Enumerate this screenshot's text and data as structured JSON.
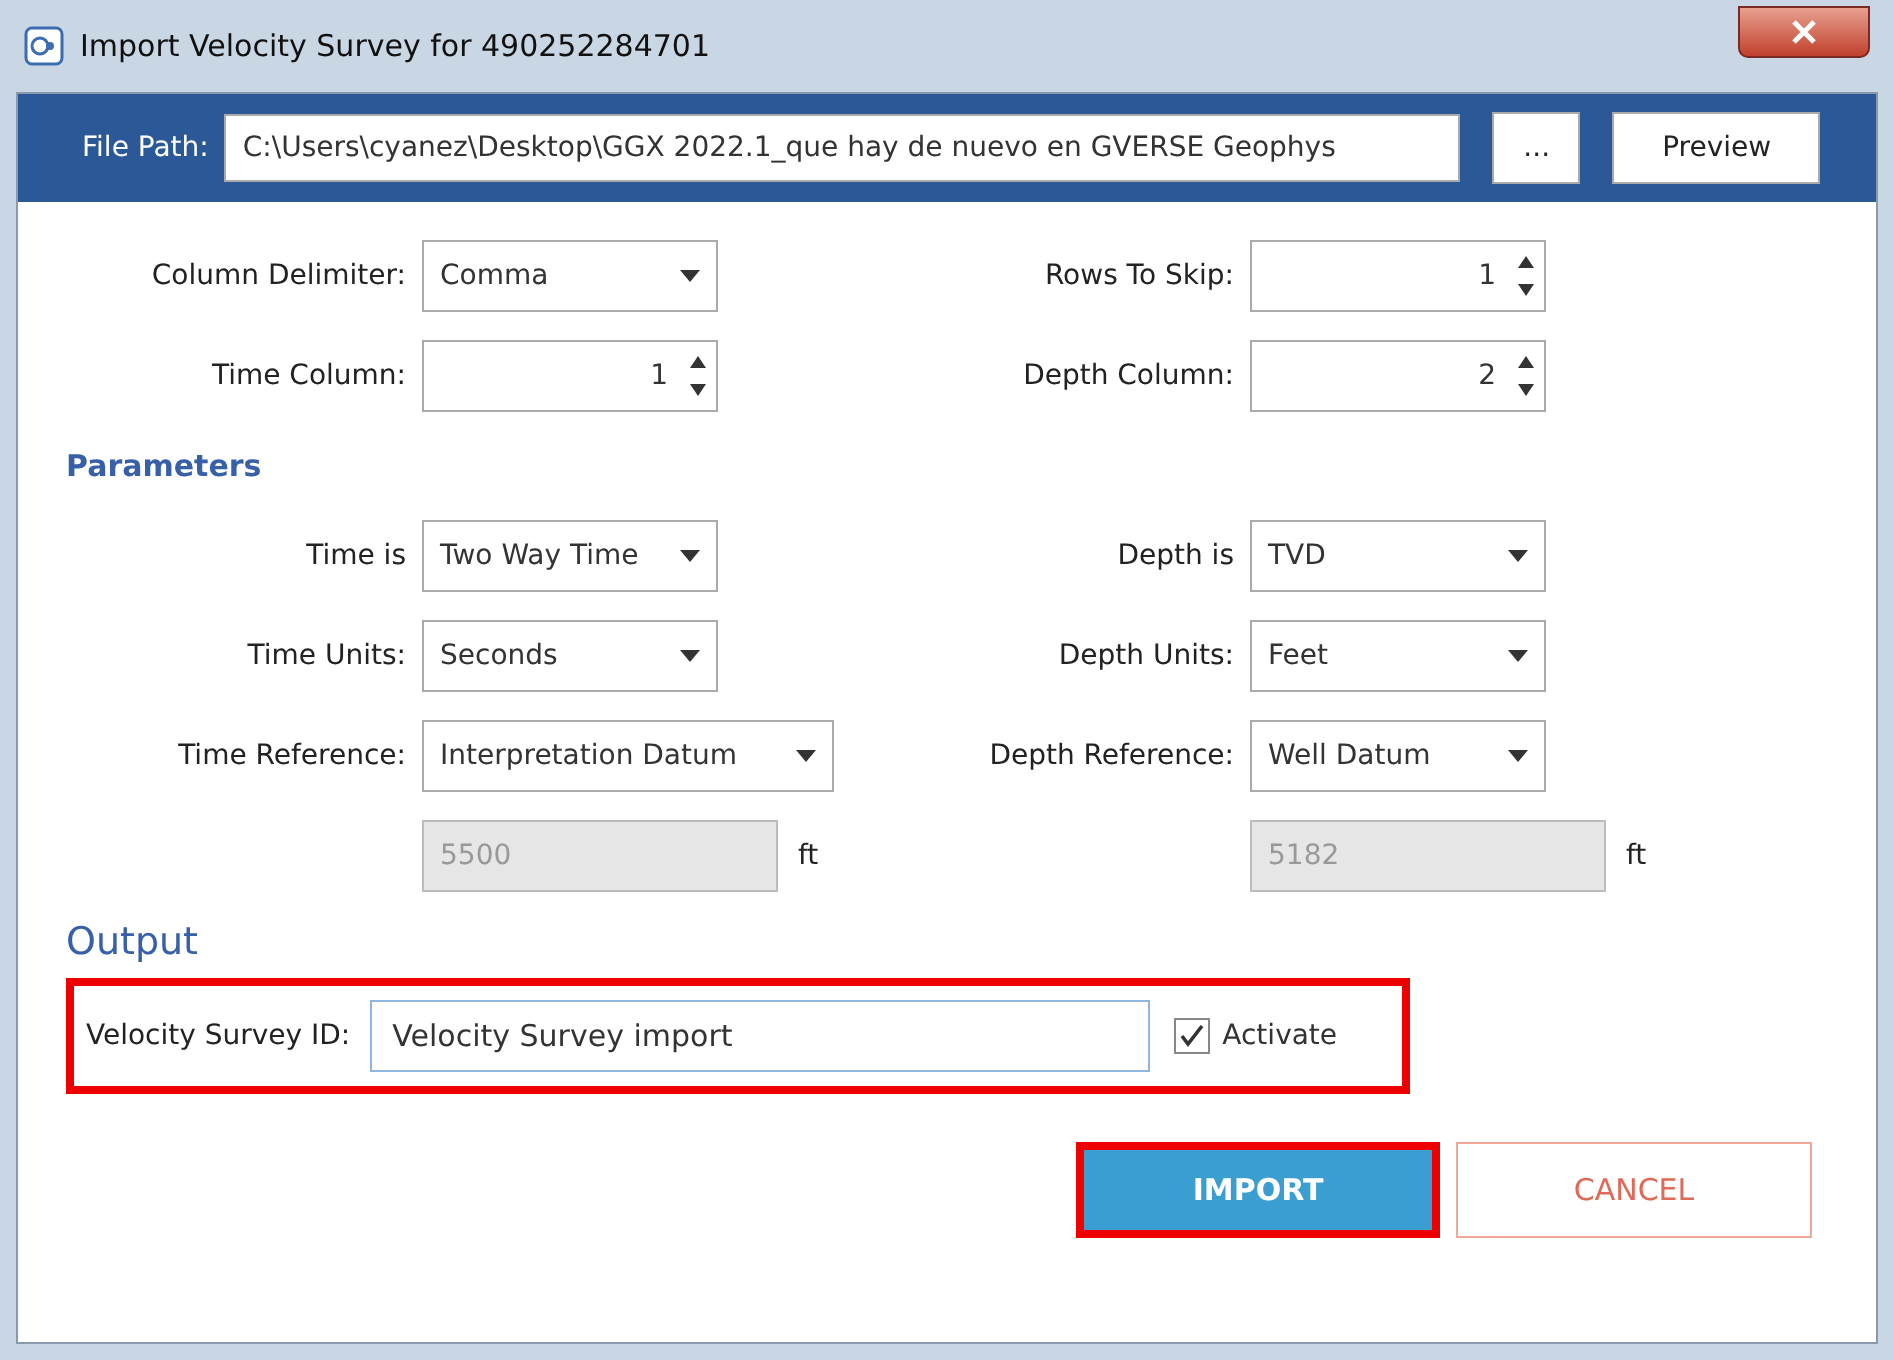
{
  "window": {
    "title": "Import Velocity Survey for 490252284701"
  },
  "file_path": {
    "label": "File Path:",
    "value": "C:\\Users\\cyanez\\Desktop\\GGX 2022.1_que hay de nuevo en GVERSE Geophys",
    "browse": "...",
    "preview": "Preview"
  },
  "format_rows": [
    [
      {
        "label": "Column Delimiter:",
        "kind": "dropdown",
        "value": "Comma"
      },
      {
        "label": "Rows To Skip:",
        "kind": "spinner",
        "value": "1"
      }
    ],
    [
      {
        "label": "Time Column:",
        "kind": "spinner",
        "value": "1"
      },
      {
        "label": "Depth Column:",
        "kind": "spinner",
        "value": "2"
      }
    ]
  ],
  "parameters": {
    "heading": "Parameters",
    "rows": [
      [
        {
          "label": "Time is",
          "kind": "dropdown",
          "value": "Two Way Time"
        },
        {
          "label": "Depth is",
          "kind": "dropdown",
          "value": "TVD"
        }
      ],
      [
        {
          "label": "Time Units:",
          "kind": "dropdown",
          "value": "Seconds"
        },
        {
          "label": "Depth Units:",
          "kind": "dropdown",
          "value": "Feet"
        }
      ],
      [
        {
          "label": "Time Reference:",
          "kind": "dropdown",
          "value": "Interpretation Datum"
        },
        {
          "label": "Depth Reference:",
          "kind": "dropdown",
          "value": "Well Datum"
        }
      ],
      [
        {
          "kind": "readonly",
          "value": "5500",
          "unit": "ft",
          "disabled": true
        },
        {
          "kind": "readonly",
          "value": "5182",
          "unit": "ft",
          "disabled": true
        }
      ]
    ]
  },
  "output": {
    "heading": "Output",
    "highlighted": true,
    "label": "Velocity Survey ID:",
    "value": "Velocity Survey import",
    "activate": {
      "label": "Activate",
      "checked": true
    }
  },
  "buttons": [
    {
      "label": "IMPORT",
      "kind": "primary",
      "highlighted": true
    },
    {
      "label": "CANCEL",
      "kind": "secondary",
      "highlighted": false
    }
  ]
}
